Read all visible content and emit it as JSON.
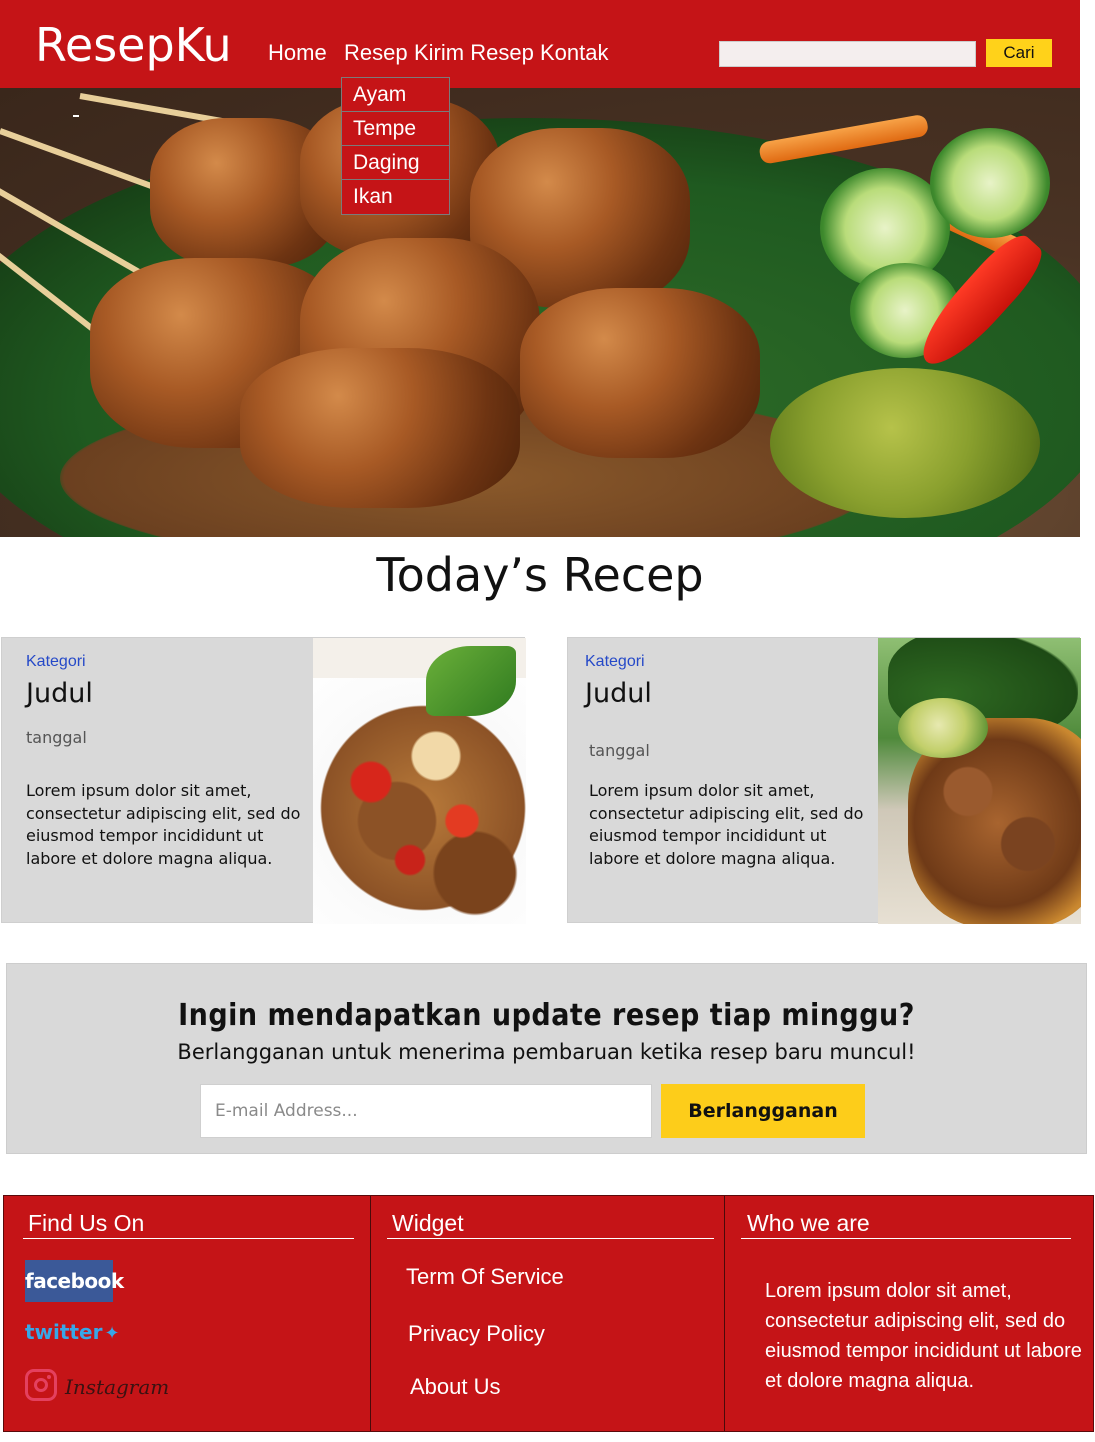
{
  "header": {
    "logo": "ResepKu",
    "nav": [
      "Home",
      "Resep",
      "Kirim Resep",
      "Kontak"
    ],
    "search_placeholder": "",
    "search_button": "Cari"
  },
  "dropdown": {
    "items": [
      "Ayam",
      "Tempe",
      "Daging",
      "Ikan"
    ]
  },
  "hero": {
    "mark": "-"
  },
  "main": {
    "section_title": "Today’s Recep",
    "cards": [
      {
        "kategori": "Kategori",
        "judul": "Judul",
        "tanggal": "tanggal",
        "excerpt": "Lorem ipsum dolor sit amet, consectetur adipiscing elit, sed do eiusmod tempor incididunt ut labore et dolore magna aliqua."
      },
      {
        "kategori": "Kategori",
        "judul": "Judul",
        "tanggal": "tanggal",
        "excerpt": "Lorem ipsum dolor sit amet, consectetur adipiscing elit, sed do eiusmod tempor incididunt ut labore et dolore magna aliqua."
      }
    ]
  },
  "newsletter": {
    "title": "Ingin mendapatkan update resep tiap minggu?",
    "subtitle": "Berlangganan untuk menerima pembaruan ketika resep baru muncul!",
    "email_placeholder": "E-mail Address...",
    "button": "Berlangganan"
  },
  "footer": {
    "find_us": {
      "heading": "Find Us On",
      "facebook": "facebook",
      "twitter": "twitter",
      "instagram": "Instagram"
    },
    "widget": {
      "heading": "Widget",
      "links": [
        "Term Of Service",
        "Privacy Policy",
        "About Us"
      ]
    },
    "who": {
      "heading": "Who we are",
      "text": "Lorem ipsum dolor sit amet, consectetur adipiscing elit, sed do eiusmod tempor incididunt ut labore et dolore magna aliqua."
    }
  },
  "colors": {
    "brand_red": "#c51417",
    "accent_yellow": "#fdcd1a",
    "card_bg": "#d9d9d9",
    "kategori_blue": "#2549c8"
  }
}
